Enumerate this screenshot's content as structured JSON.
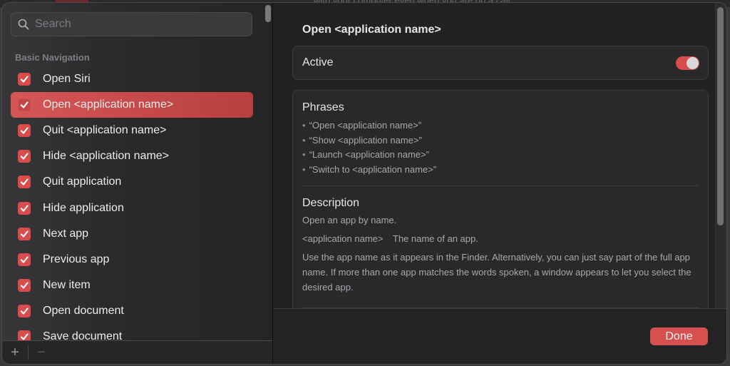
{
  "background": {
    "partial_text": "with your computer even when you are on a call"
  },
  "sidebar": {
    "search": {
      "placeholder": "Search",
      "value": ""
    },
    "section_title": "Basic Navigation",
    "items": [
      {
        "label": "Open Siri",
        "checked": true,
        "selected": false
      },
      {
        "label": "Open <application name>",
        "checked": true,
        "selected": true
      },
      {
        "label": "Quit <application name>",
        "checked": true,
        "selected": false
      },
      {
        "label": "Hide <application name>",
        "checked": true,
        "selected": false
      },
      {
        "label": "Quit application",
        "checked": true,
        "selected": false
      },
      {
        "label": "Hide application",
        "checked": true,
        "selected": false
      },
      {
        "label": "Next app",
        "checked": true,
        "selected": false
      },
      {
        "label": "Previous app",
        "checked": true,
        "selected": false
      },
      {
        "label": "New item",
        "checked": true,
        "selected": false
      },
      {
        "label": "Open document",
        "checked": true,
        "selected": false
      },
      {
        "label": "Save document",
        "checked": true,
        "selected": false
      }
    ],
    "footer": {
      "add_label": "+",
      "remove_label": "−"
    }
  },
  "detail": {
    "title": "Open <application name>",
    "active": {
      "label": "Active",
      "enabled": true
    },
    "phrases": {
      "heading": "Phrases",
      "items": [
        "“Open <application name>”",
        "“Show <application name>”",
        "“Launch <application name>”",
        "“Switch to <application name>”"
      ]
    },
    "description": {
      "heading": "Description",
      "summary": "Open an app by name.",
      "param_name": "<application name>",
      "param_desc": "The name of an app.",
      "note": "Use the app name as it appears in the Finder. Alternatively, you can just say part of the full app name. If more than one app matches the words spoken, a window appears to let you select the desired app."
    },
    "done_label": "Done"
  },
  "colors": {
    "accent": "#d94c4c",
    "selected_row": "#c94848",
    "window_bg": "#222224",
    "card_bg": "#29292b"
  }
}
